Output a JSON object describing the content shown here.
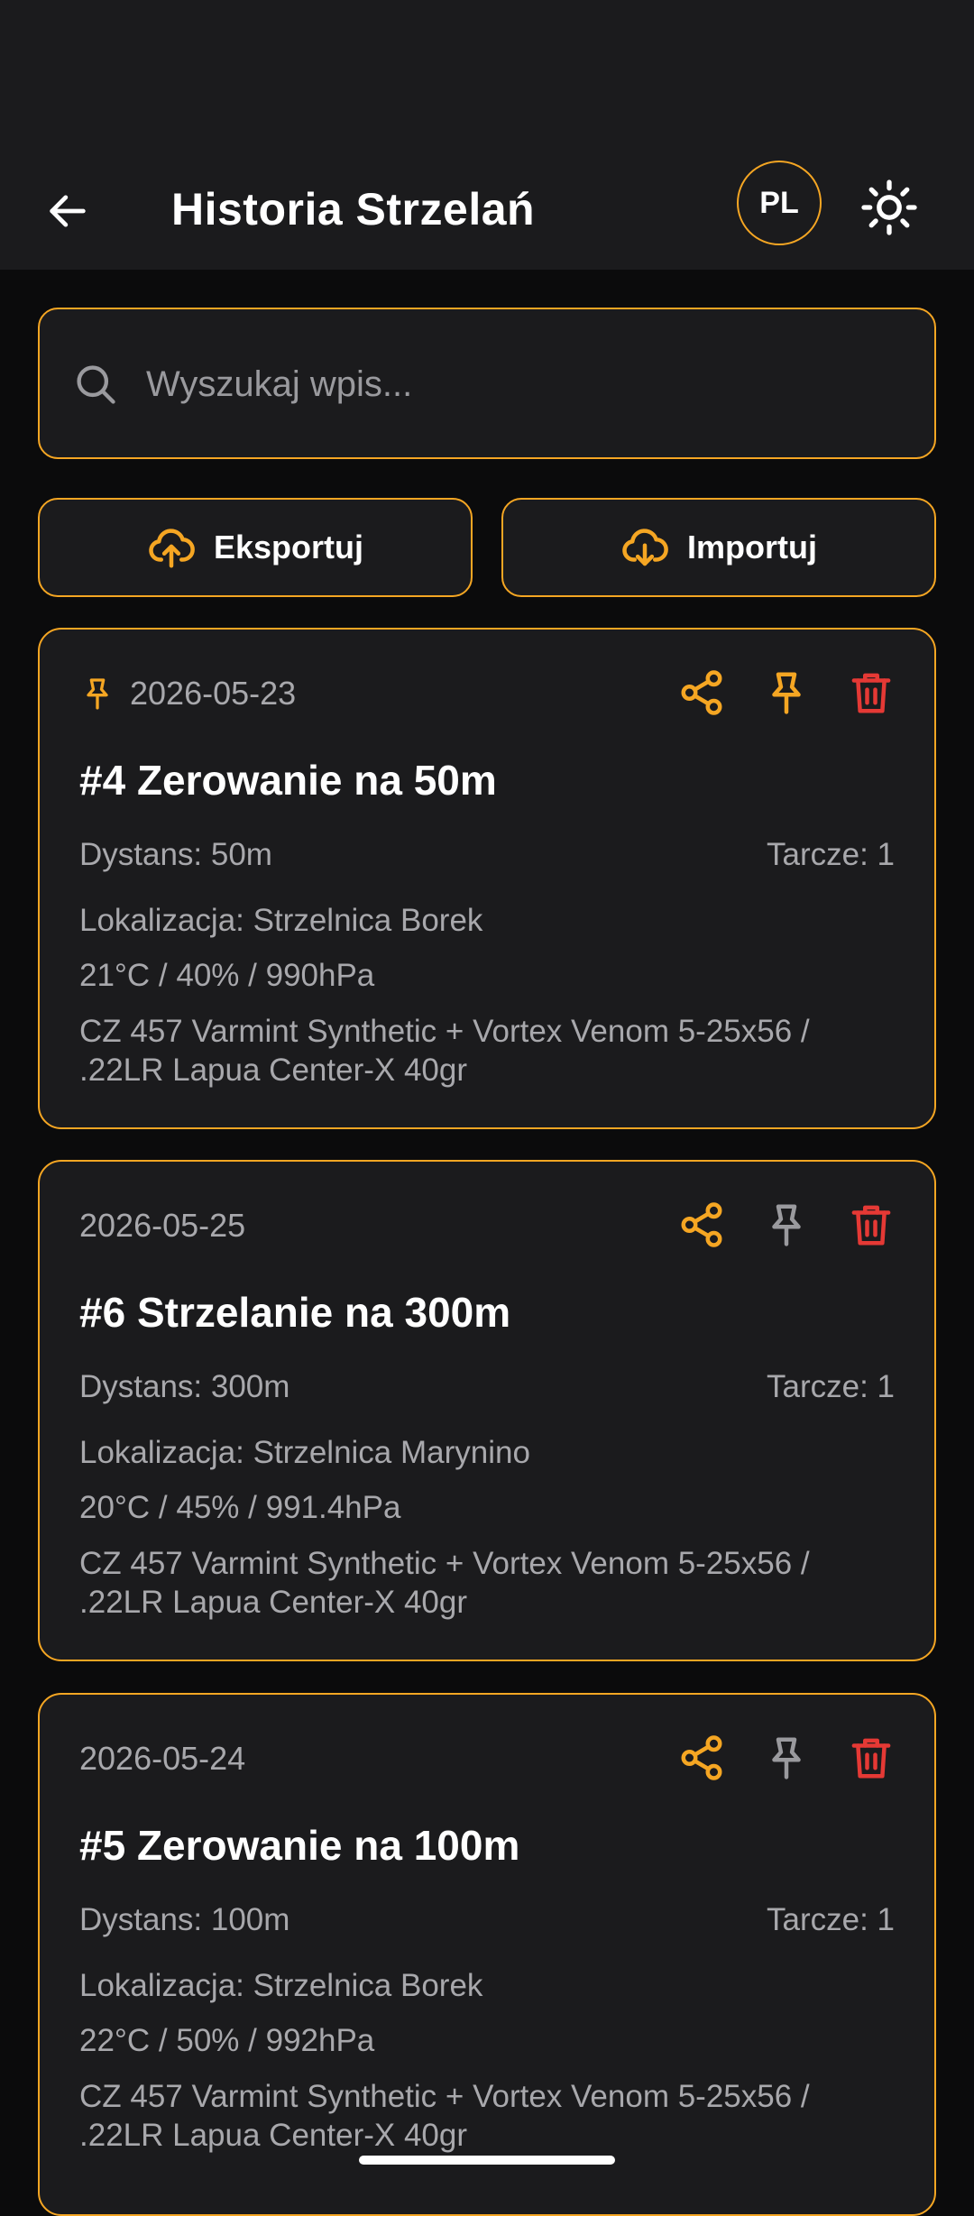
{
  "header": {
    "title": "Historia Strzelań",
    "lang_label": "PL"
  },
  "search": {
    "placeholder": "Wyszukaj wpis..."
  },
  "actions": {
    "export_label": "Eksportuj",
    "import_label": "Importuj"
  },
  "colors": {
    "accent": "#f5a623",
    "delete": "#e53935",
    "pin_inactive": "#9a9a9e",
    "background": "#0b0b0c",
    "surface": "#1b1b1d"
  },
  "entries": [
    {
      "date": "2026-05-23",
      "pinned": true,
      "title": "#4 Zerowanie na 50m",
      "distance": "Dystans: 50m",
      "targets": "Tarcze: 1",
      "location": "Lokalizacja: Strzelnica Borek",
      "weather": "21°C / 40% / 990hPa",
      "equipment": "CZ 457 Varmint Synthetic + Vortex Venom 5-25x56 / .22LR Lapua Center-X 40gr"
    },
    {
      "date": "2026-05-25",
      "pinned": false,
      "title": "#6 Strzelanie na 300m",
      "distance": "Dystans: 300m",
      "targets": "Tarcze: 1",
      "location": "Lokalizacja: Strzelnica Marynino",
      "weather": "20°C / 45% / 991.4hPa",
      "equipment": "CZ 457 Varmint Synthetic + Vortex Venom 5-25x56 / .22LR Lapua Center-X 40gr"
    },
    {
      "date": "2026-05-24",
      "pinned": false,
      "title": "#5 Zerowanie na 100m",
      "distance": "Dystans: 100m",
      "targets": "Tarcze: 1",
      "location": "Lokalizacja: Strzelnica Borek",
      "weather": "22°C / 50% / 992hPa",
      "equipment": "CZ 457 Varmint Synthetic + Vortex Venom 5-25x56 / .22LR Lapua Center-X 40gr"
    }
  ]
}
